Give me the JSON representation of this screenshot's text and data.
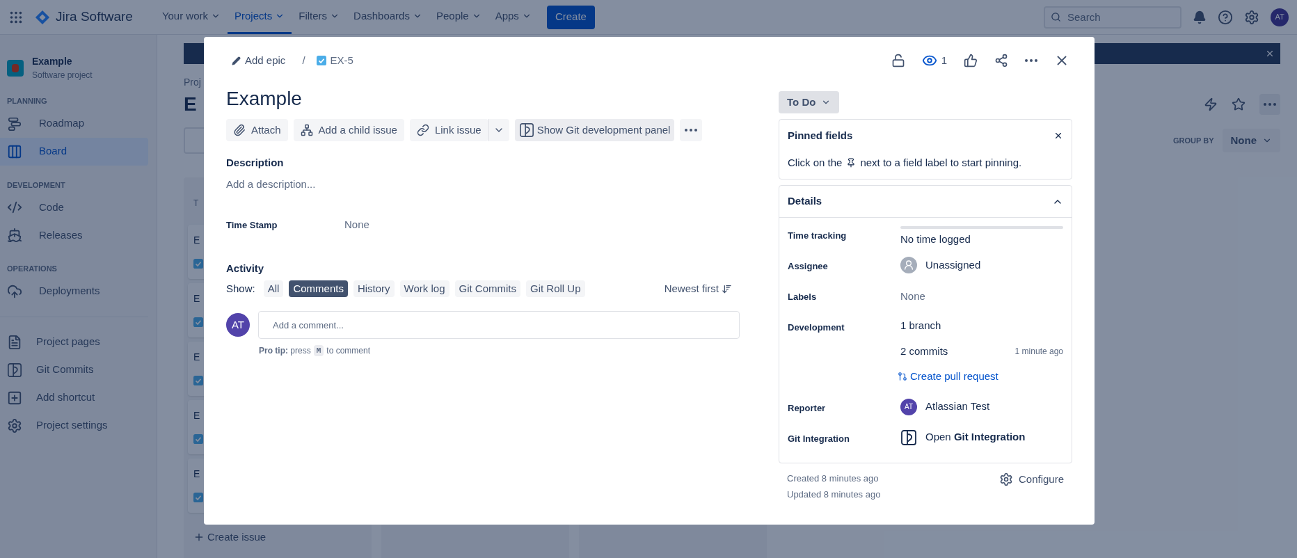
{
  "top_nav": {
    "product": "Jira Software",
    "menus": [
      {
        "label": "Your work",
        "selected": false
      },
      {
        "label": "Projects",
        "selected": true
      },
      {
        "label": "Filters",
        "selected": false
      },
      {
        "label": "Dashboards",
        "selected": false
      },
      {
        "label": "People",
        "selected": false
      },
      {
        "label": "Apps",
        "selected": false
      }
    ],
    "create": "Create",
    "search": {
      "placeholder": "Search"
    },
    "avatar": "AT"
  },
  "sidebar": {
    "project": {
      "name": "Example",
      "type": "Software project"
    },
    "sections": [
      {
        "heading": "PLANNING",
        "items": [
          {
            "label": "Roadmap",
            "selected": false
          },
          {
            "label": "Board",
            "selected": true
          }
        ]
      },
      {
        "heading": "DEVELOPMENT",
        "items": [
          {
            "label": "Code",
            "selected": false
          },
          {
            "label": "Releases",
            "selected": false
          }
        ]
      },
      {
        "heading": "OPERATIONS",
        "items": [
          {
            "label": "Deployments",
            "selected": false
          }
        ]
      }
    ],
    "links": [
      "Project pages",
      "Git Commits",
      "Add shortcut",
      "Project settings"
    ]
  },
  "board": {
    "breadcrumb": "Proj",
    "title": "E",
    "group_by": {
      "label": "GROUP BY",
      "value": "None"
    },
    "column": {
      "heading": "T",
      "cards": [
        "E",
        "E",
        "E",
        "E",
        "E"
      ],
      "create": "Create issue"
    }
  },
  "issue": {
    "epic": "Add epic",
    "separator": "/",
    "key": "EX-5",
    "watchers": "1",
    "title": "Example",
    "actions": [
      "Attach",
      "Add a child issue",
      "Link issue"
    ],
    "git_panel": "Show Git development panel",
    "description": {
      "label": "Description",
      "placeholder": "Add a description..."
    },
    "fields": [
      {
        "label": "Time Stamp",
        "value": "None"
      }
    ],
    "activity": {
      "heading": "Activity",
      "show": "Show:",
      "filters": [
        {
          "label": "All",
          "selected": false
        },
        {
          "label": "Comments",
          "selected": true
        },
        {
          "label": "History",
          "selected": false
        },
        {
          "label": "Work log",
          "selected": false
        },
        {
          "label": "Git Commits",
          "selected": false
        },
        {
          "label": "Git Roll Up",
          "selected": false
        }
      ],
      "sort": "Newest first",
      "avatar": "AT",
      "comment_placeholder": "Add a comment...",
      "tip": "**Pro tip:** press",
      "tip_key": "M",
      "tip_end": "to comment"
    },
    "status": "To Do",
    "pinned": {
      "title": "Pinned fields",
      "text_before": "Click on the",
      "text_after": "next to a field label to start pinning."
    },
    "details": {
      "title": "Details",
      "expanded": true,
      "rows": [
        {
          "kind": "progress",
          "label": "Time tracking",
          "value": "No time logged",
          "level": 0
        },
        {
          "kind": "person",
          "label": "Assignee",
          "value": "Unassigned"
        },
        {
          "kind": "text",
          "label": "Labels",
          "value": "None"
        },
        {
          "kind": "development",
          "label": "Development",
          "branch": "1 branch",
          "commits": "2 commits",
          "time": "1 minute ago",
          "link": "Create pull request"
        },
        {
          "kind": "person",
          "label": "Reporter",
          "value": "Atlassian Test",
          "initials": "AT"
        },
        {
          "kind": "app",
          "label": "Git Integration",
          "value": "Open **Git Integration**"
        }
      ]
    },
    "created": "Created 8 minutes ago",
    "updated": "Updated 8 minutes ago",
    "configure": "Configure"
  }
}
